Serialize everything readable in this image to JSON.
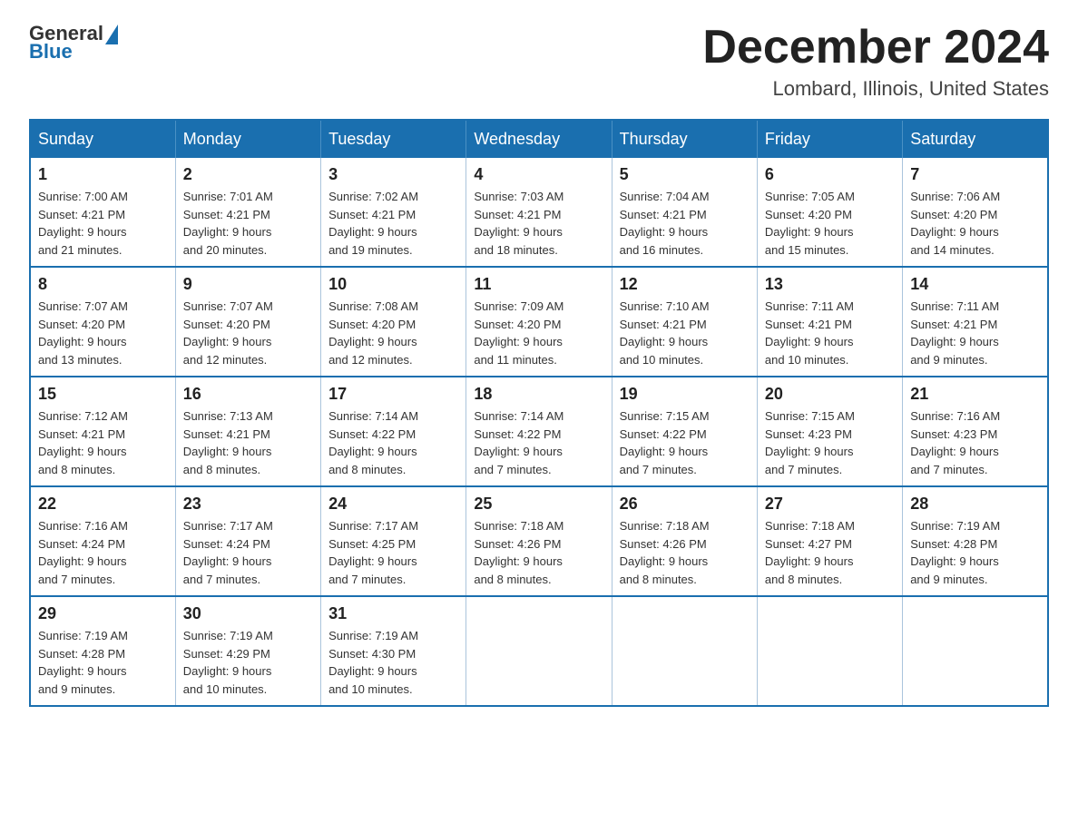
{
  "logo": {
    "general": "General",
    "blue": "Blue"
  },
  "title": "December 2024",
  "location": "Lombard, Illinois, United States",
  "days_of_week": [
    "Sunday",
    "Monday",
    "Tuesday",
    "Wednesday",
    "Thursday",
    "Friday",
    "Saturday"
  ],
  "weeks": [
    [
      {
        "day": "1",
        "sunrise": "7:00 AM",
        "sunset": "4:21 PM",
        "daylight": "9 hours and 21 minutes."
      },
      {
        "day": "2",
        "sunrise": "7:01 AM",
        "sunset": "4:21 PM",
        "daylight": "9 hours and 20 minutes."
      },
      {
        "day": "3",
        "sunrise": "7:02 AM",
        "sunset": "4:21 PM",
        "daylight": "9 hours and 19 minutes."
      },
      {
        "day": "4",
        "sunrise": "7:03 AM",
        "sunset": "4:21 PM",
        "daylight": "9 hours and 18 minutes."
      },
      {
        "day": "5",
        "sunrise": "7:04 AM",
        "sunset": "4:21 PM",
        "daylight": "9 hours and 16 minutes."
      },
      {
        "day": "6",
        "sunrise": "7:05 AM",
        "sunset": "4:20 PM",
        "daylight": "9 hours and 15 minutes."
      },
      {
        "day": "7",
        "sunrise": "7:06 AM",
        "sunset": "4:20 PM",
        "daylight": "9 hours and 14 minutes."
      }
    ],
    [
      {
        "day": "8",
        "sunrise": "7:07 AM",
        "sunset": "4:20 PM",
        "daylight": "9 hours and 13 minutes."
      },
      {
        "day": "9",
        "sunrise": "7:07 AM",
        "sunset": "4:20 PM",
        "daylight": "9 hours and 12 minutes."
      },
      {
        "day": "10",
        "sunrise": "7:08 AM",
        "sunset": "4:20 PM",
        "daylight": "9 hours and 12 minutes."
      },
      {
        "day": "11",
        "sunrise": "7:09 AM",
        "sunset": "4:20 PM",
        "daylight": "9 hours and 11 minutes."
      },
      {
        "day": "12",
        "sunrise": "7:10 AM",
        "sunset": "4:21 PM",
        "daylight": "9 hours and 10 minutes."
      },
      {
        "day": "13",
        "sunrise": "7:11 AM",
        "sunset": "4:21 PM",
        "daylight": "9 hours and 10 minutes."
      },
      {
        "day": "14",
        "sunrise": "7:11 AM",
        "sunset": "4:21 PM",
        "daylight": "9 hours and 9 minutes."
      }
    ],
    [
      {
        "day": "15",
        "sunrise": "7:12 AM",
        "sunset": "4:21 PM",
        "daylight": "9 hours and 8 minutes."
      },
      {
        "day": "16",
        "sunrise": "7:13 AM",
        "sunset": "4:21 PM",
        "daylight": "9 hours and 8 minutes."
      },
      {
        "day": "17",
        "sunrise": "7:14 AM",
        "sunset": "4:22 PM",
        "daylight": "9 hours and 8 minutes."
      },
      {
        "day": "18",
        "sunrise": "7:14 AM",
        "sunset": "4:22 PM",
        "daylight": "9 hours and 7 minutes."
      },
      {
        "day": "19",
        "sunrise": "7:15 AM",
        "sunset": "4:22 PM",
        "daylight": "9 hours and 7 minutes."
      },
      {
        "day": "20",
        "sunrise": "7:15 AM",
        "sunset": "4:23 PM",
        "daylight": "9 hours and 7 minutes."
      },
      {
        "day": "21",
        "sunrise": "7:16 AM",
        "sunset": "4:23 PM",
        "daylight": "9 hours and 7 minutes."
      }
    ],
    [
      {
        "day": "22",
        "sunrise": "7:16 AM",
        "sunset": "4:24 PM",
        "daylight": "9 hours and 7 minutes."
      },
      {
        "day": "23",
        "sunrise": "7:17 AM",
        "sunset": "4:24 PM",
        "daylight": "9 hours and 7 minutes."
      },
      {
        "day": "24",
        "sunrise": "7:17 AM",
        "sunset": "4:25 PM",
        "daylight": "9 hours and 7 minutes."
      },
      {
        "day": "25",
        "sunrise": "7:18 AM",
        "sunset": "4:26 PM",
        "daylight": "9 hours and 8 minutes."
      },
      {
        "day": "26",
        "sunrise": "7:18 AM",
        "sunset": "4:26 PM",
        "daylight": "9 hours and 8 minutes."
      },
      {
        "day": "27",
        "sunrise": "7:18 AM",
        "sunset": "4:27 PM",
        "daylight": "9 hours and 8 minutes."
      },
      {
        "day": "28",
        "sunrise": "7:19 AM",
        "sunset": "4:28 PM",
        "daylight": "9 hours and 9 minutes."
      }
    ],
    [
      {
        "day": "29",
        "sunrise": "7:19 AM",
        "sunset": "4:28 PM",
        "daylight": "9 hours and 9 minutes."
      },
      {
        "day": "30",
        "sunrise": "7:19 AM",
        "sunset": "4:29 PM",
        "daylight": "9 hours and 10 minutes."
      },
      {
        "day": "31",
        "sunrise": "7:19 AM",
        "sunset": "4:30 PM",
        "daylight": "9 hours and 10 minutes."
      },
      null,
      null,
      null,
      null
    ]
  ],
  "labels": {
    "sunrise": "Sunrise:",
    "sunset": "Sunset:",
    "daylight": "Daylight:"
  }
}
